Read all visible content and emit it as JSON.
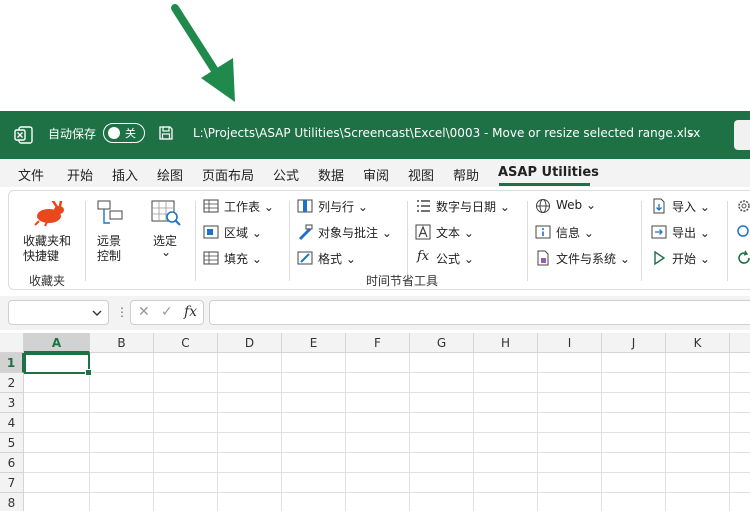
{
  "titlebar": {
    "autosave_label": "自动保存",
    "autosave_state": "关",
    "file_path": "L:\\Projects\\ASAP Utilities\\Screencast\\Excel\\0003 - Move or resize selected range.xlsx",
    "chevron": "⌄"
  },
  "tabs": [
    "文件",
    "开始",
    "插入",
    "绘图",
    "页面布局",
    "公式",
    "数据",
    "审阅",
    "视图",
    "帮助",
    "ASAP Utilities"
  ],
  "active_tab": "ASAP Utilities",
  "ribbon": {
    "favorites": {
      "line1": "收藏夹和",
      "line2": "快捷键",
      "group_label": "收藏夹"
    },
    "remote": {
      "line1": "远景",
      "line2": "控制"
    },
    "select": {
      "label": "选定",
      "chevron": "⌄"
    },
    "col1": [
      "工作表",
      "区域",
      "填充"
    ],
    "col2": [
      "列与行",
      "对象与批注",
      "格式"
    ],
    "col3": [
      "数字与日期",
      "文本",
      "公式"
    ],
    "col4": [
      "Web",
      "信息",
      "文件与系统"
    ],
    "col5": [
      "导入",
      "导出",
      "开始"
    ],
    "group_label_main": "时间节省工具",
    "dropdown": "⌄"
  },
  "formula_bar": {
    "name_box_value": "",
    "cancel_glyph": "✕",
    "enter_glyph": "✓",
    "fx_glyph": "fx",
    "formula_value": ""
  },
  "grid": {
    "columns": [
      "A",
      "B",
      "C",
      "D",
      "E",
      "F",
      "G",
      "H",
      "I",
      "J",
      "K"
    ],
    "rows": [
      "1",
      "2",
      "3",
      "4",
      "5",
      "6",
      "7",
      "8"
    ],
    "active_cell": "A1"
  },
  "colors": {
    "excel_green": "#1e7145",
    "arrow_green": "#1f8a4c"
  }
}
